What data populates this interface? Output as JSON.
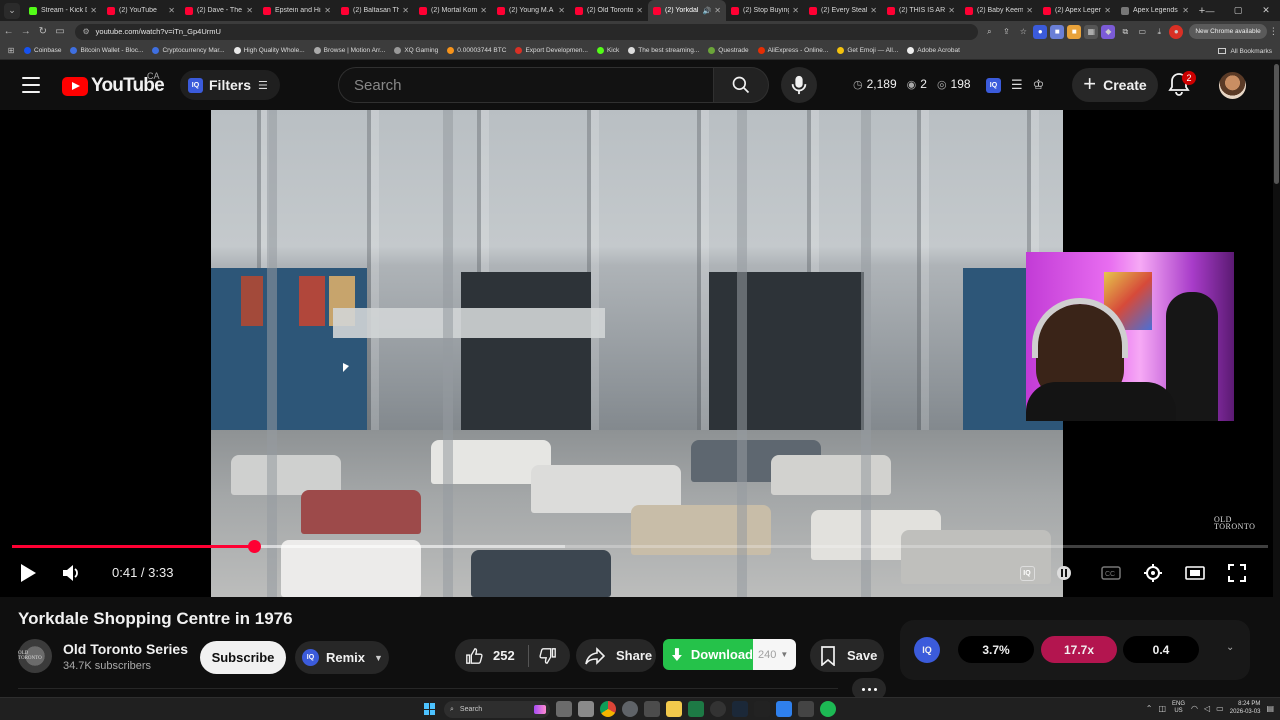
{
  "browser": {
    "tabs": [
      {
        "title": "Stream - Kick D",
        "icon": "kick-icon"
      },
      {
        "title": "(2) YouTube",
        "icon": "youtube-icon"
      },
      {
        "title": "(2) Dave - The",
        "icon": "youtube-icon"
      },
      {
        "title": "Epstein and His",
        "icon": "youtube-icon"
      },
      {
        "title": "(2) Baltasan Th",
        "icon": "youtube-icon"
      },
      {
        "title": "(2) Mortal Kom",
        "icon": "youtube-icon"
      },
      {
        "title": "(2) Young M.A",
        "icon": "youtube-icon"
      },
      {
        "title": "(2) Old Toronto",
        "icon": "youtube-icon"
      },
      {
        "title": "(2) Yorkdal",
        "icon": "youtube-icon",
        "active": true
      },
      {
        "title": "(2) Stop Buying",
        "icon": "youtube-icon"
      },
      {
        "title": "(2) Every Steal",
        "icon": "youtube-icon"
      },
      {
        "title": "(2) THIS IS ARI",
        "icon": "youtube-icon"
      },
      {
        "title": "(2) Baby Keem",
        "icon": "youtube-icon"
      },
      {
        "title": "(2) Apex Legen",
        "icon": "youtube-icon"
      },
      {
        "title": "Apex Legends",
        "icon": "apex-icon"
      }
    ],
    "url": "youtube.com/watch?v=iTn_Gp4UrmU",
    "new_chrome_label": "New Chrome available",
    "bookmarks": [
      {
        "label": "Coinbase",
        "color": "#1652f0"
      },
      {
        "label": "Bitcoin Wallet - Bloc...",
        "color": "#3f6fe0"
      },
      {
        "label": "Cryptocurrency Mar...",
        "color": "#3f6fe0"
      },
      {
        "label": "High Quality Whole...",
        "color": "#e8e8e8"
      },
      {
        "label": "Browse | Motion Arr...",
        "color": "#aaaaaa"
      },
      {
        "label": "XQ Gaming",
        "color": "#999999"
      },
      {
        "label": "0.00003744 BTC",
        "color": "#f7931a"
      },
      {
        "label": "Export Developmen...",
        "color": "#d93025"
      },
      {
        "label": "Kick",
        "color": "#53fc18"
      },
      {
        "label": "The best streaming...",
        "color": "#dddddd"
      },
      {
        "label": "Questrade",
        "color": "#6ba539"
      },
      {
        "label": "AliExpress - Online...",
        "color": "#e62e04"
      },
      {
        "label": "Get Emoji — All...",
        "color": "#f4c20d"
      },
      {
        "label": "Adobe Acrobat",
        "color": "#eeeeee"
      }
    ],
    "all_bookmarks_label": "All Bookmarks"
  },
  "masthead": {
    "logo_text": "YouTube",
    "region": "CA",
    "filters_label": "Filters",
    "iq_label": "IQ",
    "search_placeholder": "Search",
    "stats": {
      "watched": "2,189",
      "eye": "2",
      "views": "198"
    },
    "create_label": "Create",
    "notification_count": "2"
  },
  "player": {
    "current_time": "0:41",
    "duration": "3:33",
    "progress": 0.1925,
    "buffered": 0.44,
    "watermark_line1": "OLD",
    "watermark_line2": "TORONTO"
  },
  "video": {
    "title": "Yorkdale Shopping Centre in 1976",
    "channel_name": "Old Toronto Series",
    "subscribers": "34.7K subscribers",
    "channel_avatar_text": "OLD TORONTO",
    "subscribe_label": "Subscribe",
    "remix_label": "Remix",
    "likes": "252",
    "share_label": "Share",
    "download_label": "Download",
    "download_quality": "240",
    "save_label": "Save"
  },
  "iq_panel": {
    "badge": "IQ",
    "metrics": [
      {
        "value": "3.7%",
        "color": "#000000"
      },
      {
        "value": "17.7x",
        "color": "#b3154f"
      },
      {
        "value": "0.4",
        "color": "#000000"
      }
    ]
  },
  "taskbar": {
    "search_label": "Search",
    "lang_line1": "ENG",
    "lang_line2": "US",
    "time": "8:24 PM",
    "date": "2026-03-03"
  }
}
